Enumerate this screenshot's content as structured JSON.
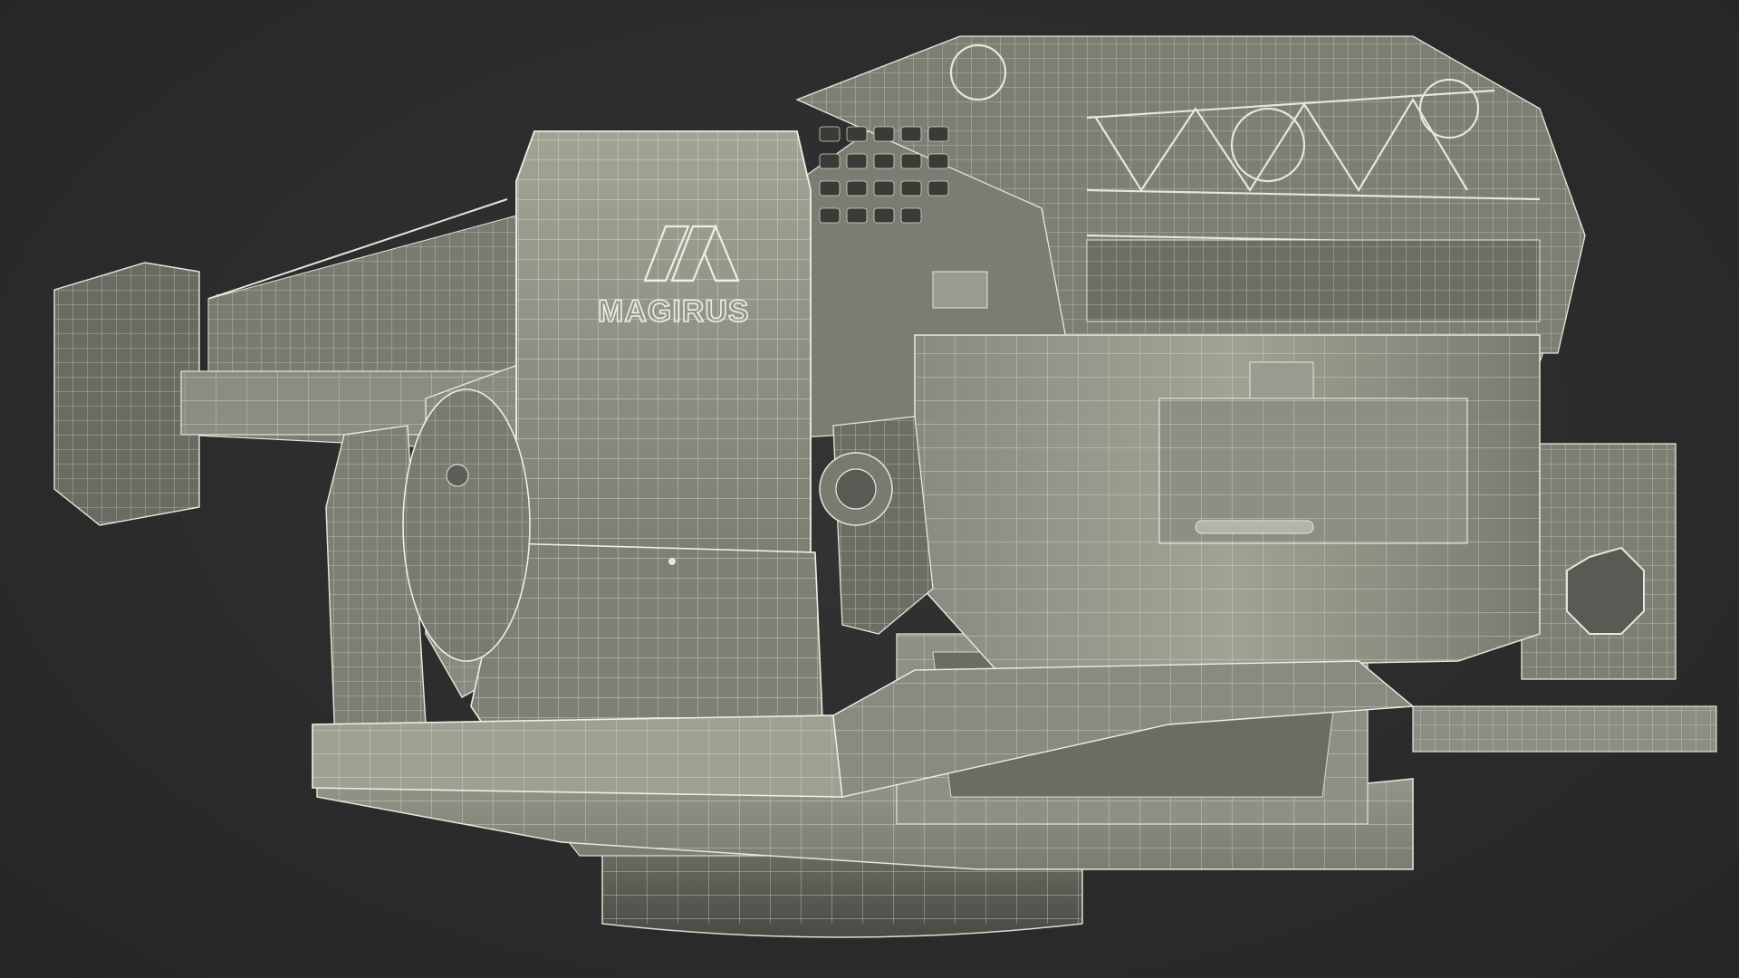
{
  "image": {
    "subject": "wireframe-3d-render",
    "logo_text": "MAGIRUS"
  },
  "colors": {
    "background": "#2c2c2c",
    "surface_light": "#9c9c8e",
    "surface_mid": "#82827a",
    "surface_dark": "#5e5e58",
    "wire": "#e6e6dc",
    "shadow": "#3a3a36"
  }
}
